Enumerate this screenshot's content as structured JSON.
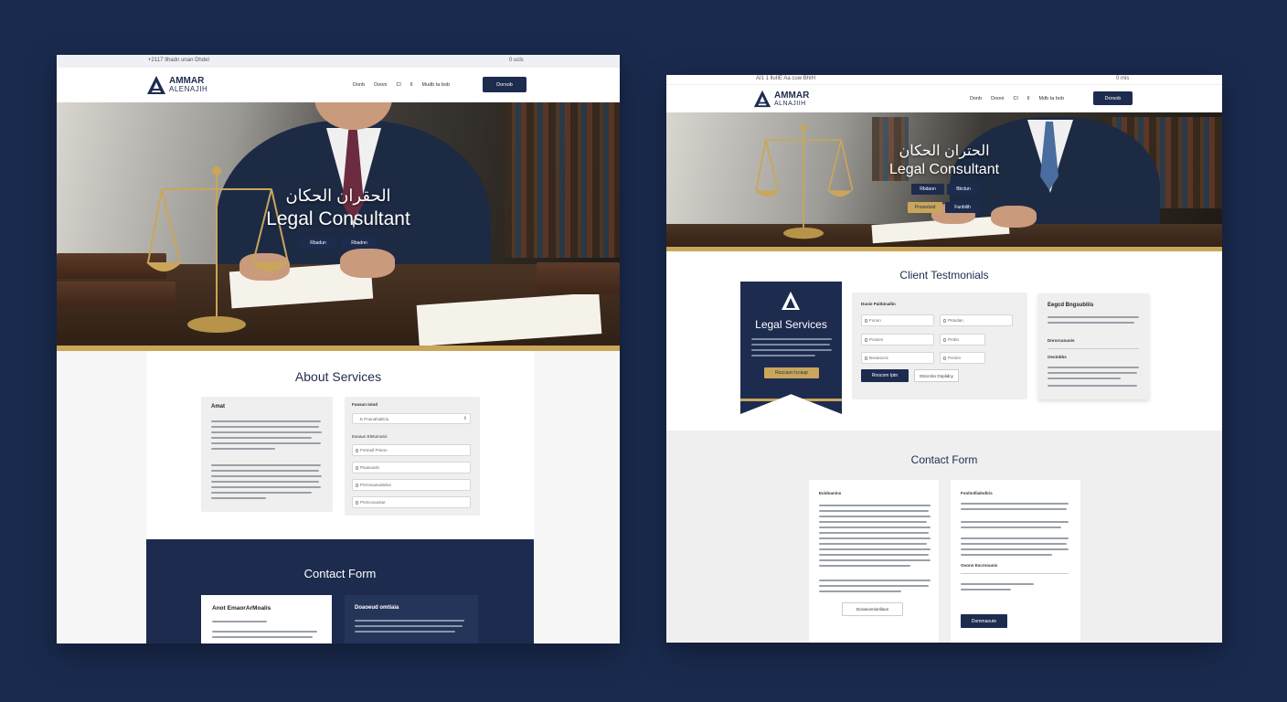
{
  "colors": {
    "navy": "#1d2b4f",
    "gold": "#c9a65a",
    "background": "#1a2a4e"
  },
  "mockA": {
    "topbar_left": "+2117 Ilhadn unan Dhdel",
    "topbar_right": "0 ucls",
    "logo": {
      "line1": "AMMAR",
      "line2": "ALENAJIH",
      "icon": "triangle-a-logo-icon"
    },
    "menu": [
      "Donb",
      "Dooni",
      "Cl",
      "Il",
      "Mudb ta bob"
    ],
    "nav_button": "Dorsob",
    "hero": {
      "arabic": "الحقران الحكان",
      "title": "Legal Consultant",
      "btn1": "Rbadun",
      "btn2": "Rbadnn"
    },
    "about": {
      "title": "About Services",
      "left_head": "Amat",
      "right_head": "Fussun Inind",
      "select": "E Pounahiatlcio",
      "right_sub": "Eanaun Eletumosic",
      "fields": [
        "Fremaif Prienn",
        "Piuanuioln",
        "Pnrnnuueuidelun",
        "Pnmcoouulue"
      ]
    },
    "contact": {
      "title": "Contact Form",
      "left_head": "Anot EmaorArMoalis",
      "right_head": "Doaoeud omtiaia"
    }
  },
  "mockB": {
    "topbar_left": "AI1 1 lluIIE Aa cuw BhIH",
    "topbar_right": "0 mis",
    "logo": {
      "line1": "AMMAR",
      "line2": "ALNAJIIH",
      "icon": "triangle-a-logo-icon"
    },
    "menu": [
      "Donb",
      "Dooni",
      "Cl",
      "Il",
      "Mdb ta bob"
    ],
    "nav_button": "Dorsob",
    "hero": {
      "arabic": "الحتران الحكان",
      "title": "Legal Consultant",
      "btn1": "Rbdaon",
      "btn2": "Bbctun",
      "btn3": "Pnoreduid",
      "btn4": "Fanbilih"
    },
    "testimonials": {
      "title": "Client Testmonials",
      "banner_title": "Legal Services",
      "banner_button": "Ruccaun Iccaup",
      "form_head": "Duoie Paitbinallin",
      "fields": [
        "Fonon",
        "Pntndan",
        "Prosien",
        "Prnbn",
        "Bonanocic",
        "Poninn"
      ],
      "submit": "Rnocom Iptn",
      "secondary": "Dtccrcbn Gnplidcy",
      "right_head": "Eegcd Bngsubliis",
      "right_sub1": "Dnrorcuouois",
      "right_sub2": "Oectnbbs"
    },
    "contact": {
      "title": "Contact Form",
      "left_head": "Eoidoanins",
      "left_button": "Doraeonnlonllaon",
      "right_head": "Fonlnnllialndiris",
      "right_sub": "Ooonn Escrnounis",
      "right_button": "Dommaoute"
    }
  }
}
